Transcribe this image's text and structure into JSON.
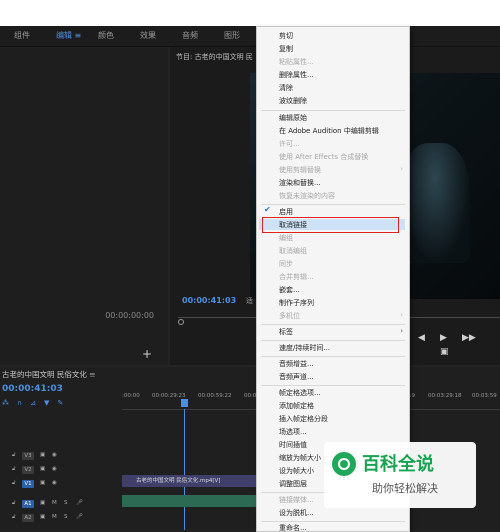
{
  "workspace_tabs": [
    {
      "label": "组件",
      "active": false
    },
    {
      "label": "编辑 ≡",
      "active": true
    },
    {
      "label": "颜色",
      "active": false
    },
    {
      "label": "效果",
      "active": false
    },
    {
      "label": "音频",
      "active": false
    },
    {
      "label": "图形",
      "active": false
    }
  ],
  "source_panel": {
    "timecode": "00:00:00:00",
    "add_label": "+"
  },
  "program_panel": {
    "title": "节目: 古老的中国文明 民",
    "timecode": "00:00:41:03",
    "timecode_fragment": "适",
    "controls": [
      "◀",
      "▶",
      "▶▶",
      "▣"
    ]
  },
  "timeline": {
    "title": "古老的中国文明 民俗文化",
    "close": "≡",
    "timecode": "00:00:41:03",
    "ruler_ticks": [
      ":00:00",
      "00:00:29:23",
      "00:00:59:22",
      "00:01:29:",
      "19",
      "00:03:29:18",
      "00:03:59"
    ],
    "tracks": [
      {
        "label": "V3",
        "kind": "video"
      },
      {
        "label": "V2",
        "kind": "video"
      },
      {
        "label": "V1",
        "kind": "video"
      },
      {
        "label": "A1",
        "kind": "audio"
      },
      {
        "label": "A2",
        "kind": "audio"
      }
    ],
    "clip_label": "古老的中国文明 民俗文化.mp4[V]",
    "track_button_m": "M",
    "track_button_s": "S"
  },
  "context_menu": {
    "items": [
      {
        "label": "剪切",
        "enabled": true
      },
      {
        "label": "复制",
        "enabled": true
      },
      {
        "label": "粘贴属性...",
        "enabled": false
      },
      {
        "label": "删除属性...",
        "enabled": true
      },
      {
        "label": "清除",
        "enabled": true
      },
      {
        "label": "波纹删除",
        "enabled": true
      },
      {
        "label": "编辑原始",
        "enabled": true
      },
      {
        "label": "在 Adobe Audition 中编辑剪辑",
        "enabled": true
      },
      {
        "label": "许可...",
        "enabled": false
      },
      {
        "label": "使用 After Effects 合成替换",
        "enabled": false
      },
      {
        "label": "使用剪辑替换",
        "enabled": false,
        "submenu": true
      },
      {
        "label": "渲染和替换...",
        "enabled": true
      },
      {
        "label": "恢复未渲染的内容",
        "enabled": false
      },
      {
        "label": "启用",
        "enabled": true,
        "checked": true
      },
      {
        "label": "取消链接",
        "enabled": true,
        "highlighted": true
      },
      {
        "label": "编组",
        "enabled": false
      },
      {
        "label": "取消编组",
        "enabled": false
      },
      {
        "label": "同步",
        "enabled": false
      },
      {
        "label": "合并剪辑...",
        "enabled": false
      },
      {
        "label": "嵌套...",
        "enabled": true
      },
      {
        "label": "制作子序列",
        "enabled": true
      },
      {
        "label": "多机位",
        "enabled": false,
        "submenu": true
      },
      {
        "label": "标签",
        "enabled": true,
        "submenu": true
      },
      {
        "label": "速度/持续时间...",
        "enabled": true
      },
      {
        "label": "音频增益...",
        "enabled": true
      },
      {
        "label": "音频声道...",
        "enabled": true
      },
      {
        "label": "帧定格选项...",
        "enabled": true
      },
      {
        "label": "添加帧定格",
        "enabled": true
      },
      {
        "label": "插入帧定格分段",
        "enabled": true
      },
      {
        "label": "场选项...",
        "enabled": true
      },
      {
        "label": "时间插值",
        "enabled": true,
        "submenu": true
      },
      {
        "label": "缩放为帧大小",
        "enabled": true
      },
      {
        "label": "设为帧大小",
        "enabled": true
      },
      {
        "label": "调整图层",
        "enabled": true
      },
      {
        "label": "链接媒体...",
        "enabled": false
      },
      {
        "label": "设为脱机...",
        "enabled": true
      },
      {
        "label": "重命名...",
        "enabled": true
      }
    ]
  },
  "watermark": {
    "title": "百科全说",
    "subtitle": "助你轻松解决"
  },
  "colors": {
    "accent": "#4a90e2",
    "highlight_box": "#e0221c",
    "watermark_green": "#18a350"
  }
}
